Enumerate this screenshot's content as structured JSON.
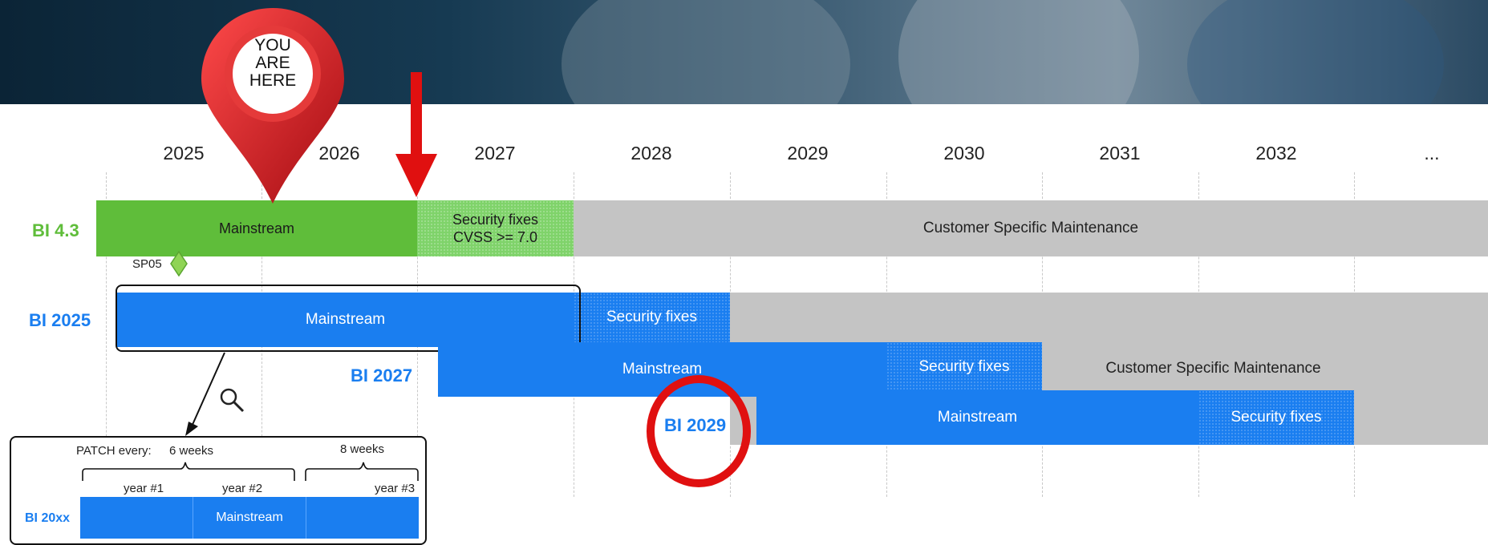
{
  "pin_label": {
    "line1": "YOU",
    "line2": "ARE",
    "line3": "HERE"
  },
  "years": [
    "2025",
    "2026",
    "2027",
    "2028",
    "2029",
    "2030",
    "2031",
    "2032",
    "..."
  ],
  "rows": {
    "bi43": {
      "label": "BI 4.3",
      "mainstream": "Mainstream",
      "security_line1": "Security fixes",
      "security_line2": "CVSS >= 7.0",
      "csm": "Customer Specific Maintenance",
      "milestone": "SP05"
    },
    "bi2025": {
      "label": "BI 2025",
      "mainstream": "Mainstream",
      "security": "Security fixes",
      "csm": "Customer Specific Maintenance"
    },
    "bi2027": {
      "label": "BI 2027",
      "mainstream": "Mainstream",
      "security": "Security fixes"
    },
    "bi2029": {
      "label": "BI 2029",
      "mainstream": "Mainstream",
      "security": "Security fixes"
    }
  },
  "detail": {
    "patch_label": "PATCH every:",
    "interval1": "6 weeks",
    "interval2": "8 weeks",
    "year1": "year #1",
    "year2": "year #2",
    "year3": "year #3",
    "row_label": "BI 20xx",
    "mainstream": "Mainstream"
  },
  "colors": {
    "green": "#5fbd3a",
    "light_green": "#7fd36a",
    "blue": "#1a7ef0",
    "grey": "#c4c4c4",
    "red": "#e01010"
  }
}
